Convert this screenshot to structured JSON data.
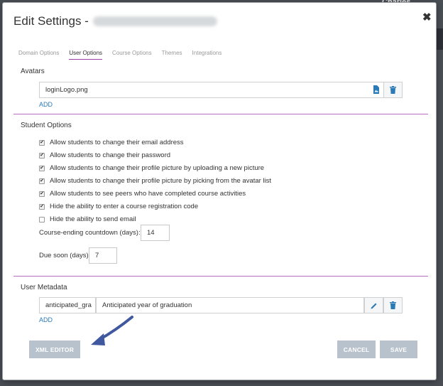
{
  "backdrop": {
    "corner_text": "Charles"
  },
  "modal": {
    "title": "Edit Settings -",
    "close_glyph": "✖"
  },
  "tabs": [
    {
      "label": "Domain Options",
      "active": false
    },
    {
      "label": "User Options",
      "active": true
    },
    {
      "label": "Course Options",
      "active": false
    },
    {
      "label": "Themes",
      "active": false
    },
    {
      "label": "Integrations",
      "active": false
    }
  ],
  "avatars": {
    "title": "Avatars",
    "file_value": "loginLogo.png",
    "add_label": "ADD"
  },
  "student_options": {
    "title": "Student Options",
    "checkboxes": [
      {
        "label": "Allow students to change their email address",
        "checked": true
      },
      {
        "label": "Allow students to change their password",
        "checked": true
      },
      {
        "label": "Allow students to change their profile picture by uploading a new picture",
        "checked": true
      },
      {
        "label": "Allow students to change their profile picture by picking from the avatar list",
        "checked": true
      },
      {
        "label": "Allow students to see peers who have completed course activities",
        "checked": true
      },
      {
        "label": "Hide the ability to enter a course registration code",
        "checked": true
      },
      {
        "label": "Hide the ability to send email",
        "checked": false
      }
    ],
    "countdown_label": "Course-ending countdown (days):",
    "countdown_value": "14",
    "due_soon_label": "Due soon (days):",
    "due_soon_value": "7"
  },
  "user_metadata": {
    "title": "User Metadata",
    "key_value": "anticipated_gra",
    "description_value": "Anticipated year of graduation",
    "add_label": "ADD"
  },
  "footer": {
    "xml_editor_label": "XML EDITOR",
    "cancel_label": "CANCEL",
    "save_label": "SAVE"
  },
  "colors": {
    "accent_divider": "#b56cbf",
    "link": "#2a7ab8",
    "button_disabled": "#b7c2cc",
    "arrow": "#3f58a0",
    "icon_blue": "#2a7ab8"
  },
  "icons": {
    "file": "file-image-icon",
    "trash": "trash-icon",
    "edit": "pencil-icon",
    "arrow": "annotation-arrow"
  }
}
